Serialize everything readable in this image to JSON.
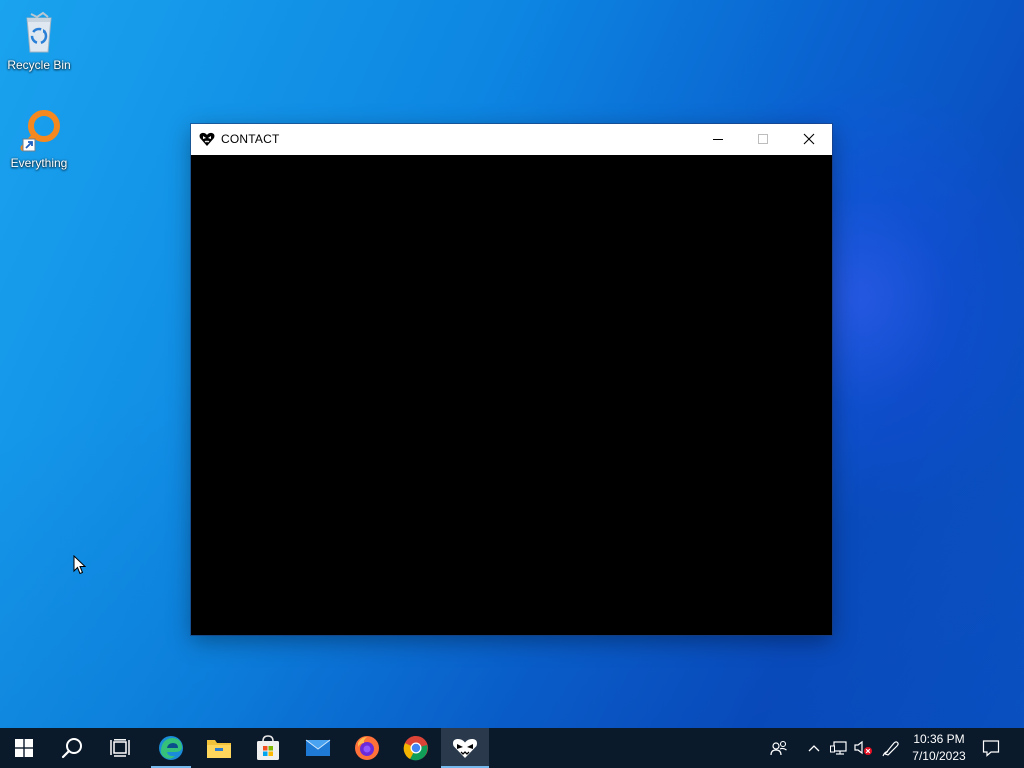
{
  "desktop": {
    "icons": [
      {
        "label": "Recycle Bin",
        "icon": "recycle-bin-icon"
      },
      {
        "label": "Everything",
        "icon": "everything-search-icon"
      }
    ]
  },
  "window": {
    "title": "CONTACT",
    "app_icon": "heart-skull-icon",
    "controls": [
      "minimize",
      "maximize",
      "close"
    ]
  },
  "taskbar": {
    "apps": [
      {
        "name": "start",
        "icon": "windows-logo-icon"
      },
      {
        "name": "search",
        "icon": "search-icon"
      },
      {
        "name": "task-view",
        "icon": "task-view-icon"
      },
      {
        "name": "edge",
        "icon": "edge-icon"
      },
      {
        "name": "file-explorer",
        "icon": "folder-icon"
      },
      {
        "name": "store",
        "icon": "store-icon"
      },
      {
        "name": "mail",
        "icon": "mail-icon"
      },
      {
        "name": "firefox",
        "icon": "firefox-icon"
      },
      {
        "name": "chrome",
        "icon": "chrome-icon"
      },
      {
        "name": "contact",
        "icon": "heart-skull-icon"
      }
    ],
    "tray": {
      "time": "10:36 PM",
      "date": "7/10/2023"
    }
  },
  "colors": {
    "accent": "#76b9ed",
    "taskbar": "#0b1a2b",
    "window_client": "#000000"
  }
}
